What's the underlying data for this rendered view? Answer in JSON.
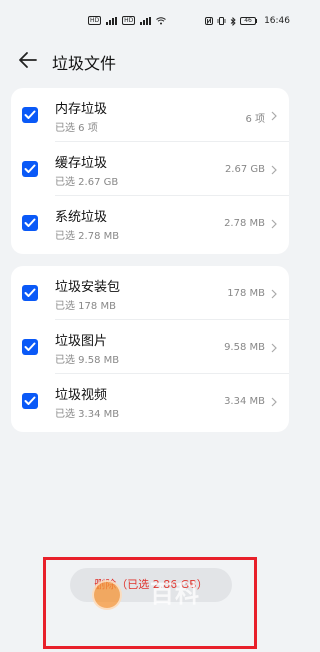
{
  "status_bar": {
    "time": "16:46",
    "battery": "46"
  },
  "header": {
    "title": "垃圾文件"
  },
  "group1": [
    {
      "title": "内存垃圾",
      "subtitle": "已选 6 项",
      "value": "6 项"
    },
    {
      "title": "缓存垃圾",
      "subtitle": "已选 2.67 GB",
      "value": "2.67 GB"
    },
    {
      "title": "系统垃圾",
      "subtitle": "已选 2.78 MB",
      "value": "2.78 MB"
    }
  ],
  "group2": [
    {
      "title": "垃圾安装包",
      "subtitle": "已选 178 MB",
      "value": "178 MB"
    },
    {
      "title": "垃圾图片",
      "subtitle": "已选 9.58 MB",
      "value": "9.58 MB"
    },
    {
      "title": "垃圾视频",
      "subtitle": "已选 3.34 MB",
      "value": "3.34 MB"
    }
  ],
  "footer": {
    "delete_label": "删除（已选 2.86 GB）"
  },
  "overlay": {
    "watermark": "百科"
  },
  "colors": {
    "accent": "#0a59f7",
    "delete_text": "#e0332c",
    "highlight": "#e8202a",
    "background": "#f1f3f5"
  },
  "icons": [
    "back-arrow-icon",
    "checkbox-checked-icon",
    "chevron-right-icon",
    "wifi-icon",
    "signal-icon",
    "battery-icon",
    "bluetooth-icon",
    "nfc-icon",
    "vibrate-icon"
  ]
}
